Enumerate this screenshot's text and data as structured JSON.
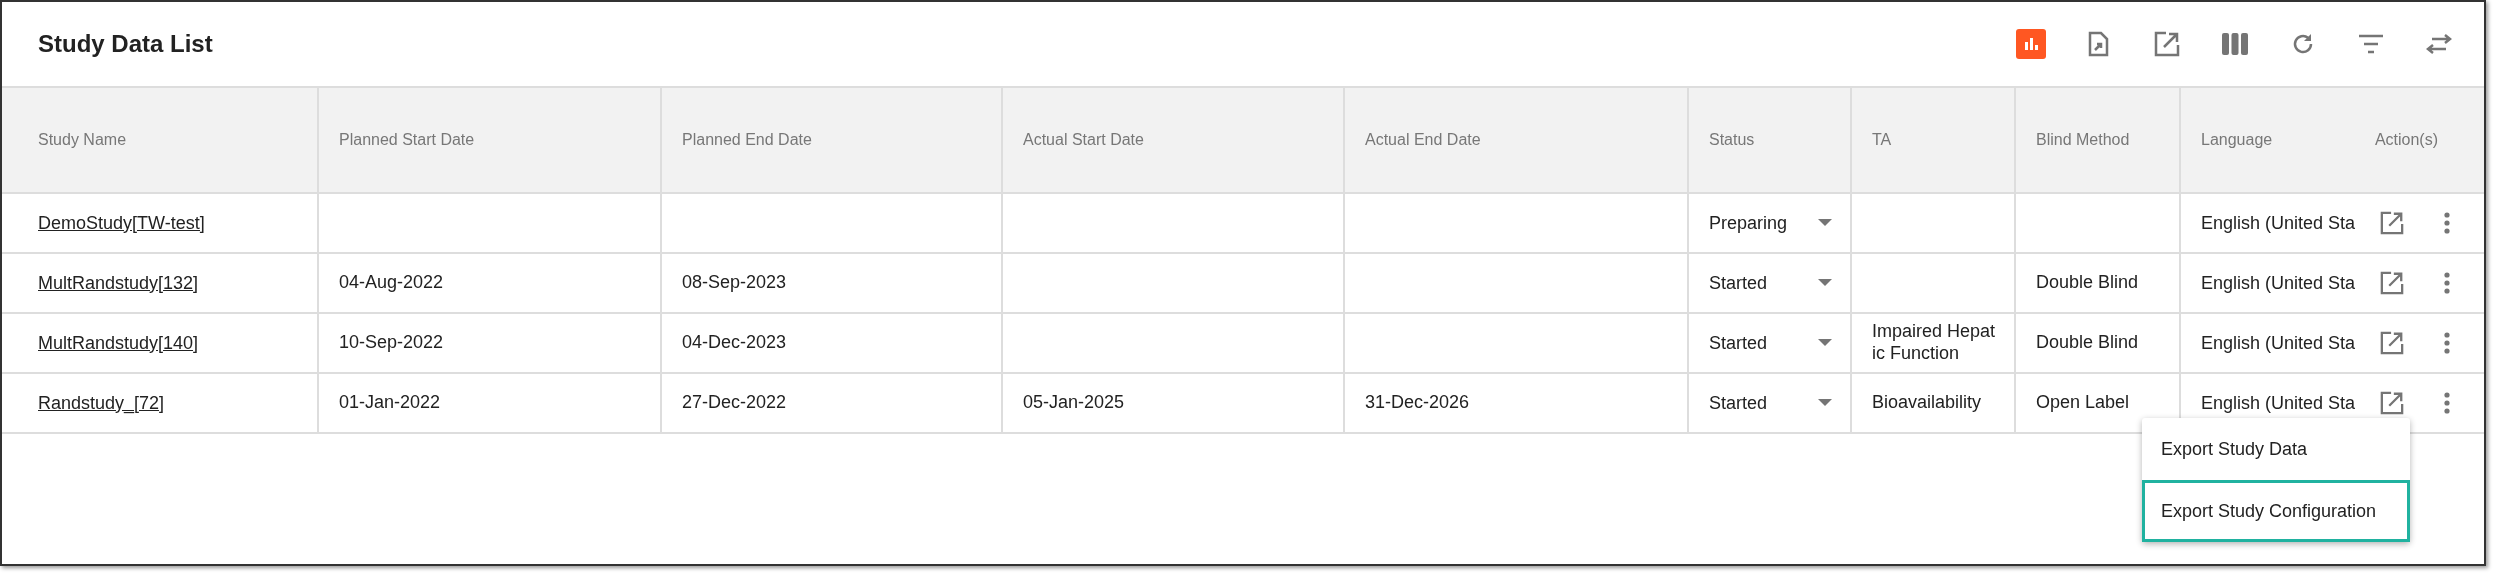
{
  "title": "Study Data List",
  "toolbar": [
    {
      "kind": "chart",
      "selected": true
    },
    {
      "kind": "file-export",
      "selected": false
    },
    {
      "kind": "open",
      "selected": false
    },
    {
      "kind": "columns",
      "selected": false
    },
    {
      "kind": "refresh",
      "selected": false
    },
    {
      "kind": "filter",
      "selected": false
    },
    {
      "kind": "swap",
      "selected": false
    }
  ],
  "table": {
    "columns": [
      "Study Name",
      "Planned Start Date",
      "Planned End Date",
      "Actual Start Date",
      "Actual End Date",
      "Status",
      "TA",
      "Blind Method",
      "Language",
      "Action(s)"
    ],
    "rows": [
      {
        "study_name": "DemoStudy[TW-test]",
        "planned_start": "",
        "planned_end": "",
        "actual_start": "",
        "actual_end": "",
        "status": "Preparing",
        "ta": "",
        "blind_method": "",
        "language": "English (United Sta"
      },
      {
        "study_name": "MultRandstudy[132]",
        "planned_start": "04-Aug-2022",
        "planned_end": "08-Sep-2023",
        "actual_start": "",
        "actual_end": "",
        "status": "Started",
        "ta": "",
        "blind_method": "Double Blind",
        "language": "English (United Sta"
      },
      {
        "study_name": "MultRandstudy[140]",
        "planned_start": "10-Sep-2022",
        "planned_end": "04-Dec-2023",
        "actual_start": "",
        "actual_end": "",
        "status": "Started",
        "ta": "Impaired Hepatic Function",
        "blind_method": "Double Blind",
        "language": "English (United Sta"
      },
      {
        "study_name": "Randstudy_[72]",
        "planned_start": "01-Jan-2022",
        "planned_end": "27-Dec-2022",
        "actual_start": "05-Jan-2025",
        "actual_end": "31-Dec-2026",
        "status": "Started",
        "ta": "Bioavailability",
        "blind_method": "Open Label",
        "language": "English (United Sta"
      }
    ]
  },
  "menu": {
    "items": [
      {
        "label": "Export Study Data",
        "selected": false
      },
      {
        "label": "Export Study Configuration",
        "selected": true
      }
    ]
  }
}
